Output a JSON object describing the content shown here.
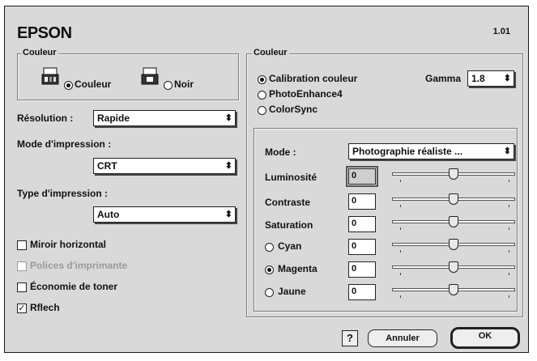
{
  "header": {
    "brand": "EPSON",
    "version": "1.01"
  },
  "couleur_left": {
    "legend": "Couleur",
    "options": [
      {
        "label": "Couleur",
        "selected": true,
        "icon": "color-printer-icon"
      },
      {
        "label": "Noir",
        "selected": false,
        "icon": "black-printer-icon"
      }
    ]
  },
  "resolution": {
    "label": "Résolution :",
    "value": "Rapide"
  },
  "mode_impression": {
    "label": "Mode d'impression :",
    "value": "CRT"
  },
  "type_impression": {
    "label": "Type d'impression :",
    "value": "Auto"
  },
  "checkboxes": [
    {
      "label": "Miroir horizontal",
      "checked": false,
      "disabled": false
    },
    {
      "label": "Polices d'imprimante",
      "checked": false,
      "disabled": true
    },
    {
      "label": "Économie de toner",
      "checked": false,
      "disabled": false
    },
    {
      "label": "Rflech",
      "checked": true,
      "disabled": false
    }
  ],
  "couleur_right": {
    "legend": "Couleur",
    "methods": [
      {
        "label": "Calibration couleur",
        "selected": true
      },
      {
        "label": "PhotoEnhance4",
        "selected": false
      },
      {
        "label": "ColorSync",
        "selected": false
      }
    ],
    "gamma": {
      "label": "Gamma",
      "value": "1.8"
    },
    "mode": {
      "label": "Mode :",
      "value": "Photographie réaliste ..."
    },
    "sliders": [
      {
        "label": "Luminosité",
        "value": "0",
        "level": 0.5
      },
      {
        "label": "Contraste",
        "value": "0",
        "level": 0.5
      },
      {
        "label": "Saturation",
        "value": "0",
        "level": 0.5
      },
      {
        "label": "Cyan",
        "value": "0",
        "level": 0.5,
        "radio": false
      },
      {
        "label": "Magenta",
        "value": "0",
        "level": 0.5,
        "radio": true
      },
      {
        "label": "Jaune",
        "value": "0",
        "level": 0.5,
        "radio": false
      }
    ]
  },
  "buttons": {
    "help": "?",
    "cancel": "Annuler",
    "ok": "OK"
  }
}
